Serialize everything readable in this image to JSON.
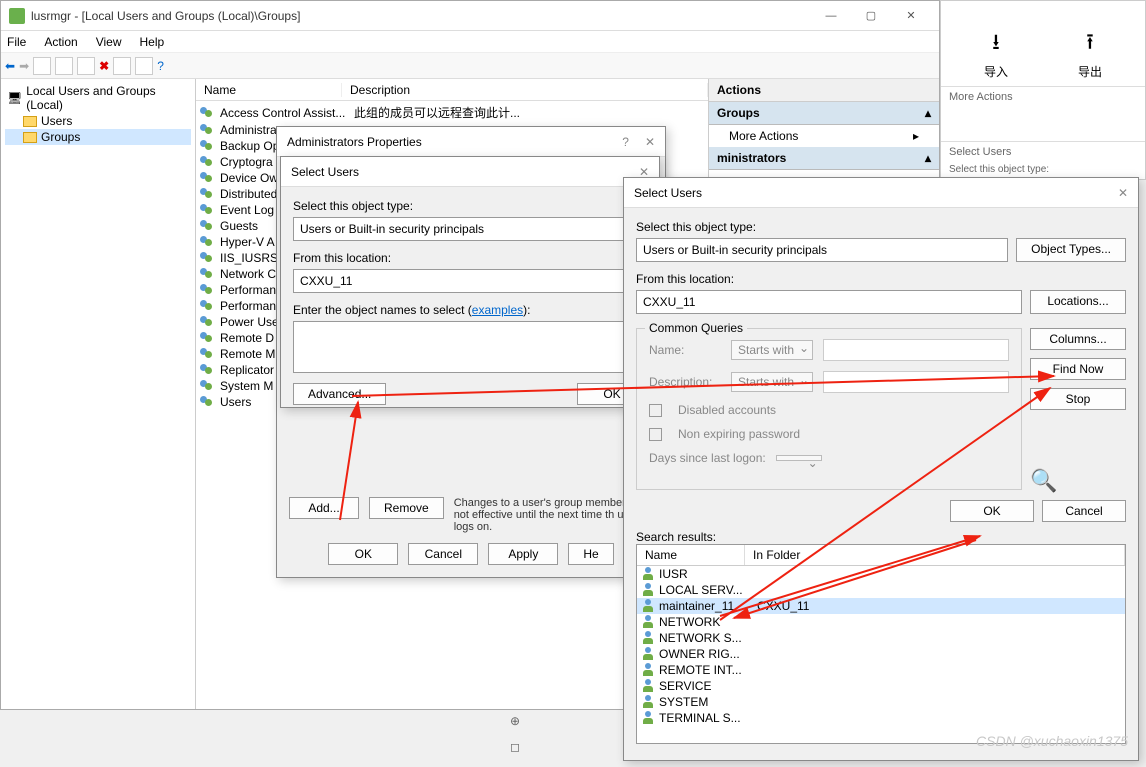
{
  "main_window": {
    "title": "lusrmgr - [Local Users and Groups (Local)\\Groups]",
    "menubar": [
      "File",
      "Action",
      "View",
      "Help"
    ],
    "tree_root": "Local Users and Groups (Local)",
    "tree_users": "Users",
    "tree_groups": "Groups",
    "list_headers": {
      "name": "Name",
      "desc": "Description"
    },
    "groups": [
      {
        "name": "Access Control Assist...",
        "desc": "此组的成员可以远程查询此计..."
      },
      {
        "name": "Administrators",
        "desc": ""
      },
      {
        "name": "Backup Op",
        "desc": ""
      },
      {
        "name": "Cryptogra",
        "desc": ""
      },
      {
        "name": "Device Ow",
        "desc": ""
      },
      {
        "name": "Distributed",
        "desc": ""
      },
      {
        "name": "Event Log",
        "desc": ""
      },
      {
        "name": "Guests",
        "desc": ""
      },
      {
        "name": "Hyper-V A",
        "desc": ""
      },
      {
        "name": "IIS_IUSRS",
        "desc": ""
      },
      {
        "name": "Network C",
        "desc": ""
      },
      {
        "name": "Performan",
        "desc": ""
      },
      {
        "name": "Performan",
        "desc": ""
      },
      {
        "name": "Power Use",
        "desc": ""
      },
      {
        "name": "Remote D",
        "desc": ""
      },
      {
        "name": "Remote M",
        "desc": ""
      },
      {
        "name": "Replicator",
        "desc": ""
      },
      {
        "name": "System M",
        "desc": ""
      },
      {
        "name": "Users",
        "desc": ""
      }
    ],
    "actions_header": "Actions",
    "actions_groups": "Groups",
    "actions_more": "More Actions",
    "actions_admins": "ministrators"
  },
  "bg": {
    "import": "导入",
    "export": "导出",
    "more_actions": "More Actions",
    "select_users": "Select Users",
    "select_type": "Select this object type:"
  },
  "admin_props": {
    "title": "Administrators Properties",
    "add": "Add...",
    "remove": "Remove",
    "note": "Changes to a user's group members are not effective until the next time th user logs on.",
    "ok": "OK",
    "cancel": "Cancel",
    "apply": "Apply",
    "help": "He"
  },
  "select_users_1": {
    "title": "Select Users",
    "obj_type_label": "Select this object type:",
    "obj_type": "Users or Built-in security principals",
    "loc_label": "From this location:",
    "loc": "CXXU_11",
    "enter_label": "Enter the object names to select",
    "examples": "examples",
    "advanced": "Advanced...",
    "ok": "OK"
  },
  "select_users_2": {
    "title": "Select Users",
    "obj_type_label": "Select this object type:",
    "obj_type": "Users or Built-in security principals",
    "obj_types_btn": "Object Types...",
    "loc_label": "From this location:",
    "loc": "CXXU_11",
    "locations_btn": "Locations...",
    "common_queries": "Common Queries",
    "name_label": "Name:",
    "desc_label": "Description:",
    "starts_with": "Starts with",
    "disabled": "Disabled accounts",
    "nonexp": "Non expiring password",
    "days_label": "Days since last logon:",
    "columns": "Columns...",
    "find_now": "Find Now",
    "stop": "Stop",
    "ok": "OK",
    "cancel": "Cancel",
    "search_results": "Search results:",
    "col_name": "Name",
    "col_folder": "In Folder",
    "results": [
      {
        "name": "IUSR",
        "folder": ""
      },
      {
        "name": "LOCAL SERV...",
        "folder": ""
      },
      {
        "name": "maintainer_11",
        "folder": "CXXU_11",
        "sel": true
      },
      {
        "name": "NETWORK",
        "folder": ""
      },
      {
        "name": "NETWORK S...",
        "folder": ""
      },
      {
        "name": "OWNER RIG...",
        "folder": ""
      },
      {
        "name": "REMOTE INT...",
        "folder": ""
      },
      {
        "name": "SERVICE",
        "folder": ""
      },
      {
        "name": "SYSTEM",
        "folder": ""
      },
      {
        "name": "TERMINAL S...",
        "folder": ""
      }
    ]
  },
  "watermark": "CSDN @xuchaoxin1375"
}
